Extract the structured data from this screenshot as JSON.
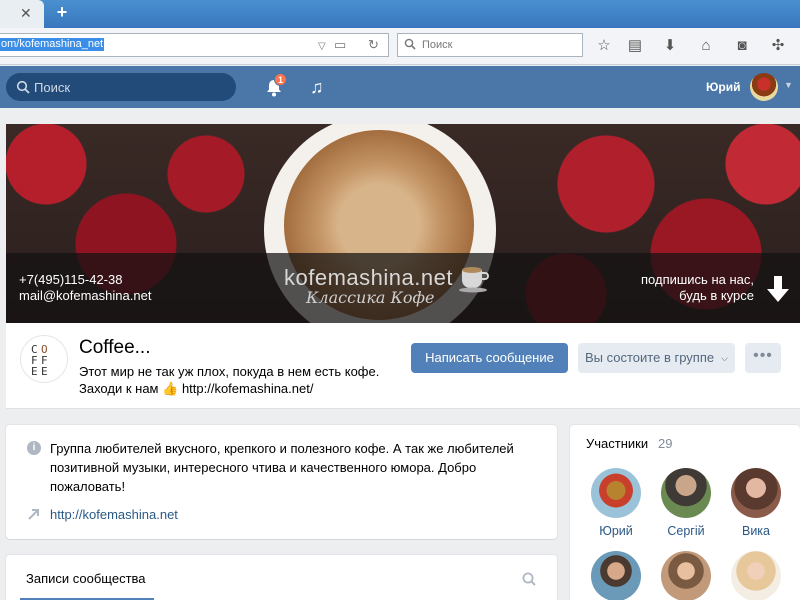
{
  "browser": {
    "tab_close_icon": "close-icon",
    "new_tab_icon": "plus-icon",
    "url": "om/kofemashina_net",
    "search_placeholder": "Поиск",
    "toolbar_icons": [
      "star-icon",
      "clipboard-icon",
      "download-icon",
      "home-icon",
      "pocket-icon",
      "extension-icon"
    ]
  },
  "vk_header": {
    "search_placeholder": "Поиск",
    "notifications_count": "1",
    "user_name": "Юрий"
  },
  "cover": {
    "phone": "+7(495)115-42-38",
    "email": "mail@kofemashina.net",
    "logo_text": "kofemashina.net",
    "slogan": "Классика Кофе",
    "subscribe_line1": "подпишись на нас,",
    "subscribe_line2": "будь в курсе"
  },
  "group": {
    "avatar_letters": [
      "C",
      "O",
      "F",
      "F",
      "E",
      "E"
    ],
    "title": "Coffee...",
    "status_line1": "Этот мир не так уж плох, покуда в нем есть кофе.",
    "status_line2_prefix": "Заходи к нам",
    "status_line2_link": "http://kofemashina.net/",
    "message_button": "Написать сообщение",
    "member_button": "Вы состоите в группе",
    "more_button": "•••"
  },
  "info": {
    "description": "Группа любителей вкусного, крепкого и полезного кофе. А так же любителей позитивной музыки, интересного чтива и качественного юмора. Добро пожаловать!",
    "link": "http://kofemashina.net"
  },
  "posts": {
    "title": "Записи сообщества"
  },
  "members": {
    "title": "Участники",
    "count": "29",
    "items": [
      {
        "name": "Юрий",
        "color": "#c8402c"
      },
      {
        "name": "Сергій",
        "color": "#6b8a52"
      },
      {
        "name": "Вика",
        "color": "#8a5a4a"
      },
      {
        "name": "",
        "color": "#6a9ab8"
      },
      {
        "name": "",
        "color": "#c29a7a"
      },
      {
        "name": "",
        "color": "#e6c89a"
      }
    ]
  },
  "colors": {
    "vk_blue": "#4a76a8",
    "button_blue": "#5181b8",
    "link_blue": "#2a5885",
    "badge_orange": "#ff734c"
  }
}
